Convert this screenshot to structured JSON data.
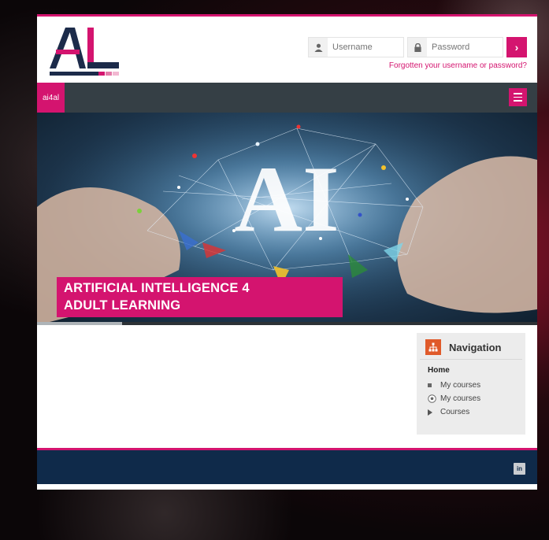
{
  "header": {
    "logo_text": "AL",
    "username_placeholder": "Username",
    "password_placeholder": "Password",
    "login_button": "›",
    "forgot_link": "Forgotten your username or password?"
  },
  "navbar": {
    "site_name": "ai4al"
  },
  "hero": {
    "title_line1": "ARTIFICIAL INTELLIGENCE 4",
    "title_line2": "ADULT LEARNING",
    "image_text": "AI"
  },
  "navigation": {
    "title": "Navigation",
    "home": "Home",
    "items": [
      {
        "label": "My courses",
        "icon": "square-bullet-icon"
      },
      {
        "label": "My courses",
        "icon": "soccer-ball-icon"
      },
      {
        "label": "Courses",
        "icon": "caret-right-icon"
      }
    ]
  },
  "footer": {
    "social": "in"
  },
  "colors": {
    "accent": "#d4146f",
    "navbar": "#353f45",
    "footer": "#0f2a4a",
    "logo_navy": "#1c2b4a"
  }
}
